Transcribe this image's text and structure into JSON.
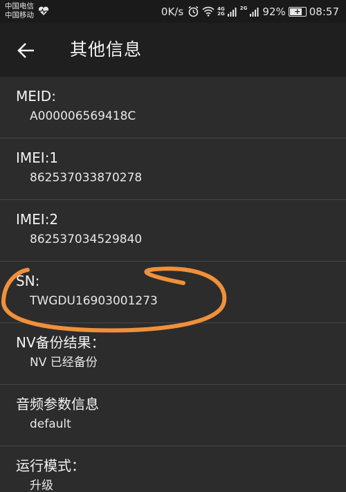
{
  "status_bar": {
    "carrier_1": "中国电信",
    "carrier_2": "中国移动",
    "net_speed": "0K/s",
    "net_type_1_top": "4G",
    "net_type_1_bottom": "2G",
    "net_type_2": "2G",
    "battery": "92%",
    "time": "08:57",
    "icons": [
      "heart-rate-icon",
      "alarm-icon",
      "wifi-icon",
      "signal-icon",
      "battery-icon"
    ]
  },
  "app_bar": {
    "title": "其他信息",
    "back_icon": "arrow-left-icon"
  },
  "items": [
    {
      "label": "MEID:",
      "value": "A000006569418C"
    },
    {
      "label": "IMEI:1",
      "value": "862537033870278"
    },
    {
      "label": "IMEI:2",
      "value": "862537034529840"
    },
    {
      "label": "SN:",
      "value": "TWGDU16903001273"
    },
    {
      "label": "NV备份结果：",
      "value": "NV 已经备份"
    },
    {
      "label": "音频参数信息",
      "value": "default"
    },
    {
      "label": "运行模式：",
      "value": "升级"
    }
  ],
  "colors": {
    "background": "#2c2c2c",
    "app_bar": "#1f1f1f",
    "status_bar": "#1a1a1a",
    "annotation": "#f0903a"
  }
}
